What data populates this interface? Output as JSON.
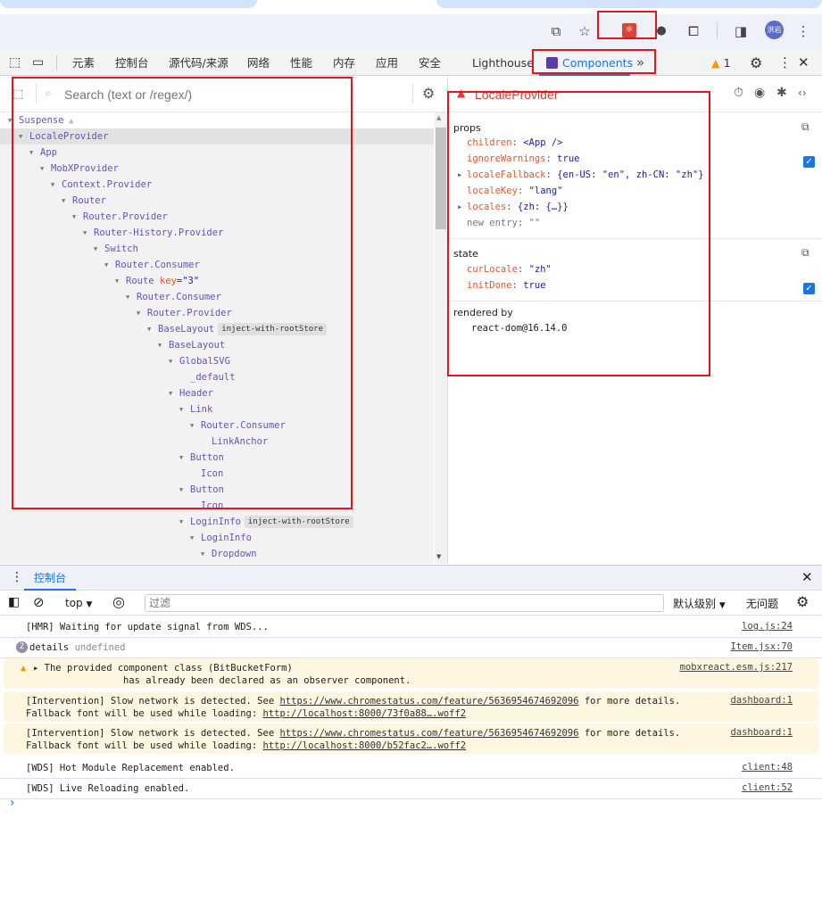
{
  "browser": {
    "profile_label": "洪岩",
    "icons": [
      "translate-icon",
      "star-icon",
      "react-devtools-extension-icon",
      "github-icon",
      "extensions-icon",
      "side-panel-icon",
      "avatar",
      "more-vert-icon"
    ]
  },
  "devtools": {
    "tabs": [
      "元素",
      "控制台",
      "源代码/来源",
      "网络",
      "性能",
      "内存",
      "应用",
      "安全",
      "Lighthouse"
    ],
    "active_tab": "Components",
    "more_tabs": "»",
    "warning_count": "1"
  },
  "components": {
    "search_placeholder": "Search (text or /regex/)",
    "tree": [
      {
        "name": "Suspense",
        "depth": 0,
        "arrow": true,
        "warn": true
      },
      {
        "name": "LocaleProvider",
        "depth": 1,
        "arrow": true,
        "selected": true
      },
      {
        "name": "App",
        "depth": 2,
        "arrow": true
      },
      {
        "name": "MobXProvider",
        "depth": 3,
        "arrow": true
      },
      {
        "name": "Context.Provider",
        "depth": 4,
        "arrow": true
      },
      {
        "name": "Router",
        "depth": 5,
        "arrow": true
      },
      {
        "name": "Router.Provider",
        "depth": 6,
        "arrow": true
      },
      {
        "name": "Router-History.Provider",
        "depth": 7,
        "arrow": true
      },
      {
        "name": "Switch",
        "depth": 8,
        "arrow": true
      },
      {
        "name": "Router.Consumer",
        "depth": 9,
        "arrow": true
      },
      {
        "name": "Route",
        "depth": 10,
        "arrow": true,
        "key": "\"3\""
      },
      {
        "name": "Router.Consumer",
        "depth": 11,
        "arrow": true
      },
      {
        "name": "Router.Provider",
        "depth": 12,
        "arrow": true
      },
      {
        "name": "BaseLayout",
        "depth": 13,
        "arrow": true,
        "badge": "inject-with-rootStore"
      },
      {
        "name": "BaseLayout",
        "depth": 14,
        "arrow": true
      },
      {
        "name": "GlobalSVG",
        "depth": 15,
        "arrow": true
      },
      {
        "name": "_default",
        "depth": 16,
        "arrow": false
      },
      {
        "name": "Header",
        "depth": 15,
        "arrow": true
      },
      {
        "name": "Link",
        "depth": 16,
        "arrow": true
      },
      {
        "name": "Router.Consumer",
        "depth": 17,
        "arrow": true
      },
      {
        "name": "LinkAnchor",
        "depth": 18,
        "arrow": false
      },
      {
        "name": "Button",
        "depth": 16,
        "arrow": true
      },
      {
        "name": "Icon",
        "depth": 17,
        "arrow": false
      },
      {
        "name": "Button",
        "depth": 16,
        "arrow": true
      },
      {
        "name": "Icon",
        "depth": 17,
        "arrow": false
      },
      {
        "name": "LoginInfo",
        "depth": 16,
        "arrow": true,
        "badge": "inject-with-rootStore"
      },
      {
        "name": "LoginInfo",
        "depth": 17,
        "arrow": true
      },
      {
        "name": "Dropdown",
        "depth": 18,
        "arrow": true
      }
    ],
    "key_label": "key"
  },
  "detail": {
    "title": "LocaleProvider",
    "props_label": "props",
    "props": [
      {
        "key": "children",
        "value": "<App />",
        "expand": false
      },
      {
        "key": "ignoreWarnings",
        "value": "true",
        "expand": false
      },
      {
        "key": "localeFallback",
        "value": "{en-US: \"en\", zh-CN: \"zh\"}",
        "expand": true
      },
      {
        "key": "localeKey",
        "value": "\"lang\"",
        "expand": false
      },
      {
        "key": "locales",
        "value": "{zh: {…}}",
        "expand": true
      },
      {
        "key": "new entry",
        "value": "\"\"",
        "expand": false,
        "muted": true
      }
    ],
    "state_label": "state",
    "state": [
      {
        "key": "curLocale",
        "value": "\"zh\""
      },
      {
        "key": "initDone",
        "value": "true"
      }
    ],
    "rendered_by_label": "rendered by",
    "rendered_by": "react-dom@16.14.0"
  },
  "console": {
    "tab": "控制台",
    "context": "top",
    "filter_placeholder": "过滤",
    "level": "默认级别",
    "issues": "无问题",
    "messages": [
      {
        "text": "[HMR] Waiting for update signal from WDS...",
        "source": "log.js:24"
      },
      {
        "count": "2",
        "text": "details",
        "extra": "undefined",
        "source": "Item.jsx:70"
      },
      {
        "warn": true,
        "line1": "The provided component class (BitBucketForm)",
        "line2": "has already been declared as an observer component.",
        "source": "mobxreact.esm.js:217"
      },
      {
        "warn": true,
        "pre": "[Intervention] Slow network is detected. See ",
        "link": "https://www.chromestatus.com/feature/5636954674692096",
        "post": " for more details.",
        "line2pre": "Fallback font will be used while loading: ",
        "link2": "http://localhost:8000/73f0a88….woff2",
        "source": "dashboard:1"
      },
      {
        "warn": true,
        "pre": "[Intervention] Slow network is detected. See ",
        "link": "https://www.chromestatus.com/feature/5636954674692096",
        "post": " for more details.",
        "line2pre": "Fallback font will be used while loading: ",
        "link2": "http://localhost:8000/b52fac2….woff2",
        "source": "dashboard:1"
      },
      {
        "text": "[WDS] Hot Module Replacement enabled.",
        "source": "client:48"
      },
      {
        "text": "[WDS] Live Reloading enabled.",
        "source": "client:52"
      }
    ],
    "prompt": "›"
  },
  "colors": {
    "accent": "#1a73e8",
    "component": "#6a51b2",
    "prop_key": "#e2552e",
    "prop_value": "#1a1aa6",
    "warning_bg": "#fef6e0",
    "annotation": "#e8141c"
  }
}
